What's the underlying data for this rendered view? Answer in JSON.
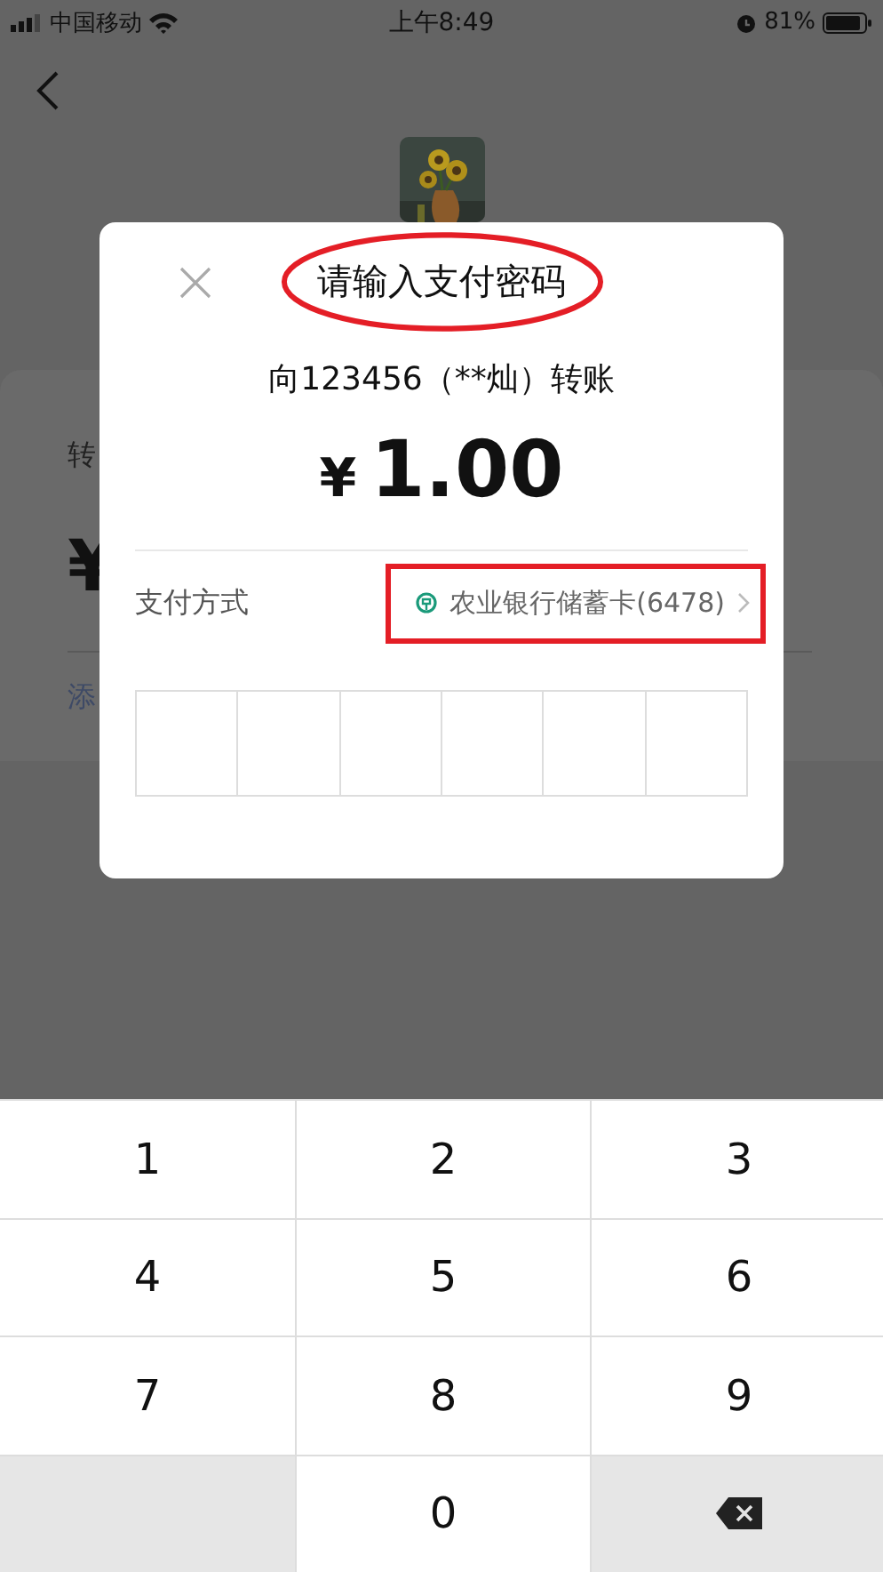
{
  "status_bar": {
    "carrier": "中国移动",
    "time": "上午8:49",
    "battery": "81%"
  },
  "background_card": {
    "label": "转",
    "amount": "¥",
    "link": "添"
  },
  "dialog": {
    "title": {
      "text": "请输入支付密码",
      "circled": true
    },
    "recipient": "向123456（**灿）转账",
    "currency": "¥",
    "amount": "1.00",
    "payment": {
      "label": "支付方式",
      "method": "农业银行储蓄卡(6478)",
      "boxed": true
    },
    "pin_cells": [
      {
        "filled": false
      },
      {
        "filled": false
      },
      {
        "filled": false
      },
      {
        "filled": false
      },
      {
        "filled": false
      },
      {
        "filled": false
      }
    ]
  },
  "keypad": [
    {
      "kind": "digit",
      "label": "1"
    },
    {
      "kind": "digit",
      "label": "2"
    },
    {
      "kind": "digit",
      "label": "3"
    },
    {
      "kind": "digit",
      "label": "4"
    },
    {
      "kind": "digit",
      "label": "5"
    },
    {
      "kind": "digit",
      "label": "6"
    },
    {
      "kind": "digit",
      "label": "7"
    },
    {
      "kind": "digit",
      "label": "8"
    },
    {
      "kind": "digit",
      "label": "9"
    },
    {
      "kind": "blank"
    },
    {
      "kind": "digit",
      "label": "0"
    },
    {
      "kind": "delete"
    }
  ]
}
